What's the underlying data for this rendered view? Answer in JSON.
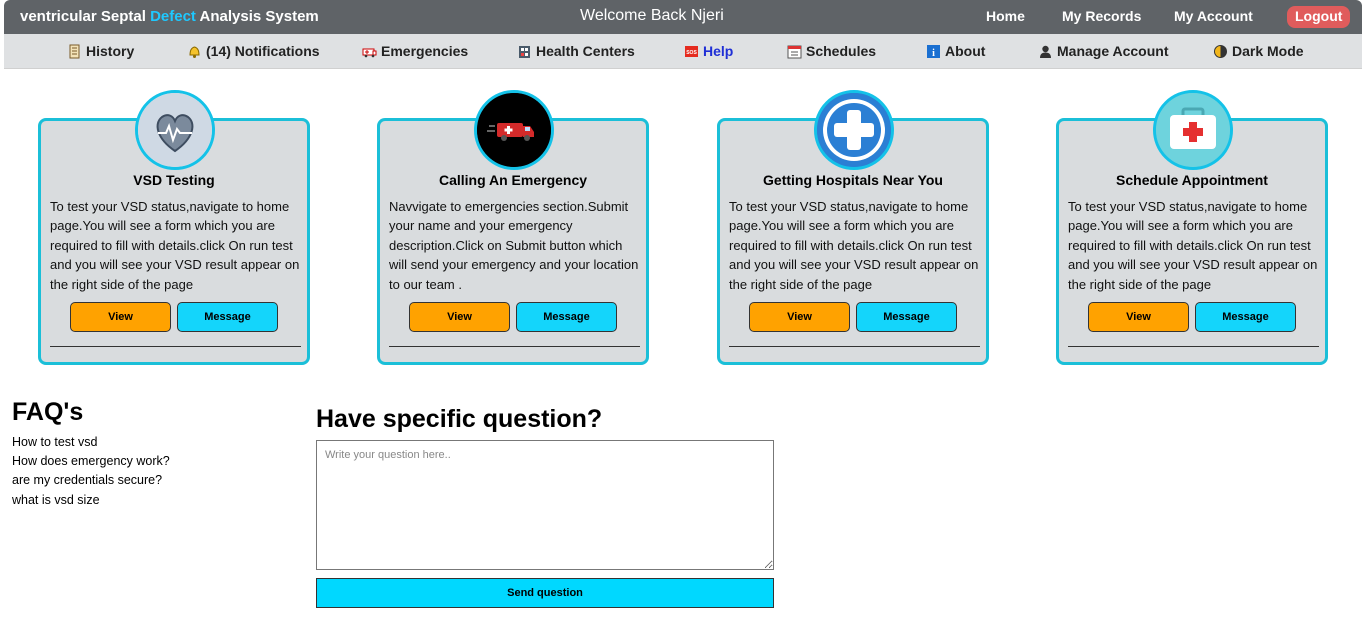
{
  "header": {
    "brand_pre": "ventricular Septal ",
    "brand_accent": "Defect",
    "brand_post": " Analysis System",
    "welcome": "Welcome Back Njeri",
    "links": [
      "Home",
      "My Records",
      "My Account"
    ],
    "logout": "Logout"
  },
  "nav": {
    "items": [
      {
        "label": "History",
        "icon": "scroll-icon"
      },
      {
        "label": "(14) Notifications",
        "icon": "bell-icon"
      },
      {
        "label": "Emergencies",
        "icon": "ambulance-icon"
      },
      {
        "label": "Health Centers",
        "icon": "hospital-icon"
      },
      {
        "label": "Help",
        "icon": "sos-icon"
      },
      {
        "label": "Schedules",
        "icon": "calendar-icon"
      },
      {
        "label": "About",
        "icon": "info-icon"
      },
      {
        "label": "Manage Account",
        "icon": "user-icon"
      },
      {
        "label": "Dark Mode",
        "icon": "half-moon-icon"
      }
    ]
  },
  "cards": [
    {
      "title": "VSD Testing",
      "text": "To test your VSD status,navigate to home page.You will see a form which you are required to fill with details.click On run test and you will see your VSD result appear on the right side of the page",
      "view": "View",
      "message": "Message",
      "icon": "heart-icon"
    },
    {
      "title": "Calling An Emergency",
      "text": "Navvigate to emergencies section.Submit your name and your emergency description.Click on Submit button which will send your emergency and your location to our team .",
      "view": "View",
      "message": "Message",
      "icon": "ambulance-icon"
    },
    {
      "title": "Getting Hospitals Near You",
      "text": "To test your VSD status,navigate to home page.You will see a form which you are required to fill with details.click On run test and you will see your VSD result appear on the right side of the page",
      "view": "View",
      "message": "Message",
      "icon": "medical-cross-icon"
    },
    {
      "title": "Schedule Appointment",
      "text": "To test your VSD status,navigate to home page.You will see a form which you are required to fill with details.click On run test and you will see your VSD result appear on the right side of the page",
      "view": "View",
      "message": "Message",
      "icon": "first-aid-kit-icon"
    }
  ],
  "faq": {
    "title": "FAQ's",
    "items": [
      "How to test vsd",
      "How does emergency work?",
      "are my credentials secure?",
      "what is vsd size"
    ]
  },
  "question": {
    "title": "Have specific question?",
    "placeholder": "Write your question here..",
    "send": "Send question"
  },
  "colors": {
    "topbar": "#5f6367",
    "accent": "#1ec8ff",
    "card_border": "#1bbfd8",
    "view_button": "#ffa200",
    "message_button": "#14d5fb",
    "logout": "#e05c5c"
  }
}
